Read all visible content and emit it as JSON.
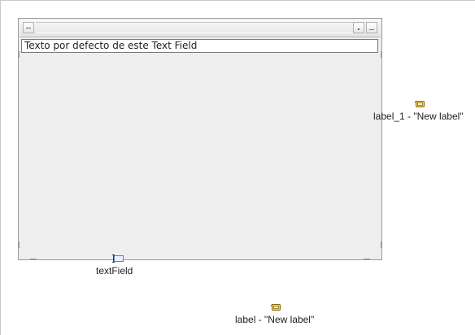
{
  "frame": {
    "textfield": {
      "value": "Texto por defecto de este Text Field"
    }
  },
  "components": {
    "textfield_label": "textField",
    "label_1_caption": "label_1 - \"New label\"",
    "label_caption": "label - \"New label\""
  },
  "icons": {
    "label_bean": "label-bean-icon",
    "textfield_bean": "textfield-bean-icon"
  },
  "colors": {
    "frame_bg": "#eeeeee",
    "textfield_bg": "#ffffff",
    "icon_gold": "#c9a227"
  }
}
